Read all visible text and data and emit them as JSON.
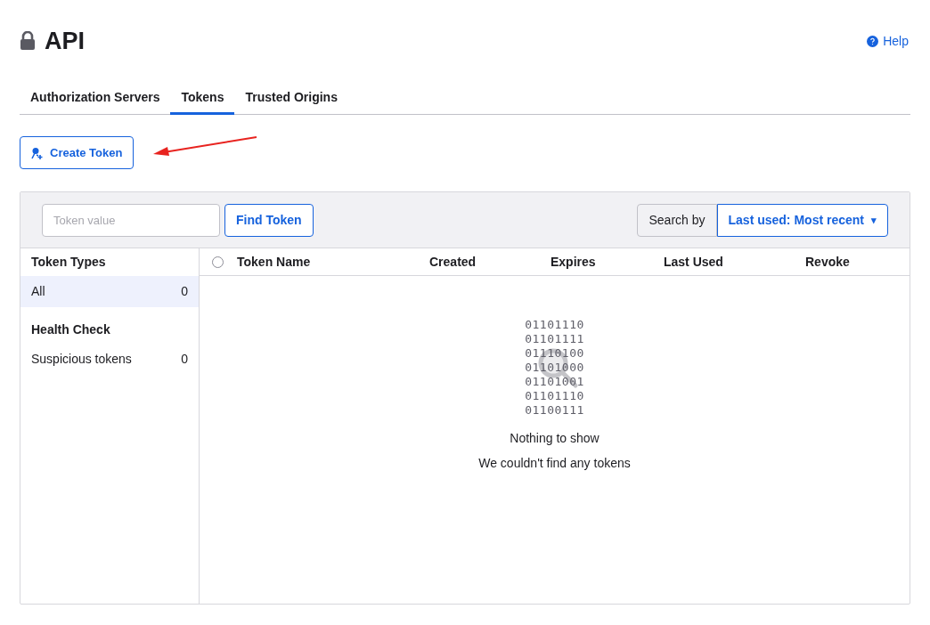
{
  "page": {
    "title": "API",
    "help": "Help"
  },
  "tabs": [
    {
      "label": "Authorization Servers",
      "selected": false
    },
    {
      "label": "Tokens",
      "selected": true
    },
    {
      "label": "Trusted Origins",
      "selected": false
    }
  ],
  "create_button": "Create Token",
  "toolbar": {
    "search": {
      "placeholder": "Token value"
    },
    "find_button": "Find Token",
    "search_by_label": "Search by",
    "sort": "Last used: Most recent",
    "sort_caret": "▾"
  },
  "sidebar": {
    "sections": [
      {
        "title": "Token Types",
        "items": [
          {
            "label": "All",
            "count": "0",
            "selected": true
          }
        ]
      },
      {
        "title": "Health Check",
        "items": [
          {
            "label": "Suspicious tokens",
            "count": "0",
            "selected": false
          }
        ]
      }
    ]
  },
  "table": {
    "select_all_checked": false,
    "columns": [
      "Token Name",
      "Created",
      "Expires",
      "Last Used",
      "Revoke"
    ]
  },
  "empty_state": {
    "binary": [
      "01101110",
      "01101111",
      "01110100",
      "01101000",
      "01101001",
      "01101110",
      "01100111"
    ],
    "title": "Nothing to show",
    "message": "We couldn't find any tokens"
  }
}
